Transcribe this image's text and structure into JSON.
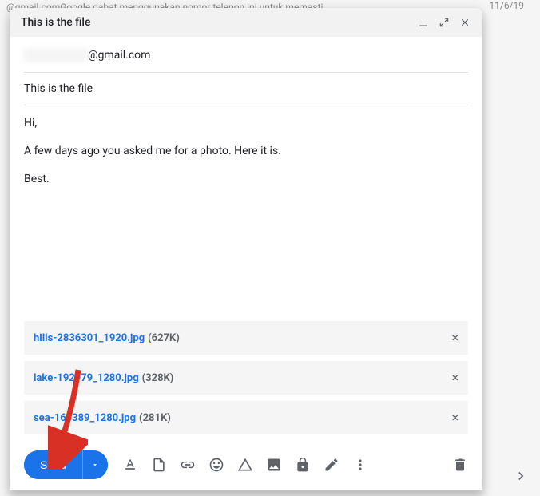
{
  "background": {
    "preview_text": "@gmail.comGoogle dabat menggunakan nomor telepon ini untuk memasti...",
    "date": "11/6/19"
  },
  "compose": {
    "title": "This is the file",
    "recipient_suffix": "@gmail.com",
    "subject": "This is the file",
    "body_lines": [
      "Hi,",
      "A few days ago you asked me for a photo. Here it is.",
      "Best."
    ]
  },
  "attachments": [
    {
      "name": "hills-2836301_1920.jpg",
      "size": "(627K)"
    },
    {
      "name": "lake-192979_1280.jpg",
      "size": "(328K)"
    },
    {
      "name": "sea-163389_1280.jpg",
      "size": "(281K)"
    }
  ],
  "footer": {
    "send_label": "Send"
  }
}
